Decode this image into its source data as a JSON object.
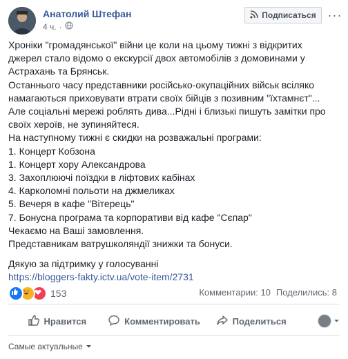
{
  "post": {
    "author": "Анатолий Штефан",
    "time": "4 ч.",
    "subscribe_label": "Подписаться",
    "lines": [
      "Хроніки \"громадянської\" війни це коли на цьому тижні з відкритих",
      "джерел стало відомо о екскурсії двох автомобілів з домовинами у",
      "Астрахань та Брянськ.",
      "Останнього часу представники російсько-окупаційних військ всіляко",
      "намагаються приховувати втрати своїх бійців з позивним \"їхтамнєт\"...",
      "Але соціальні мережі роблять дива...Рідні і близькі пишуть замітки про",
      "своїх хероїв, не зупиняйтеся.",
      "На наступному тижні є скидки на розважальні програми:",
      "1. Концерт Кобзона",
      "1. Концерт хору Александрова",
      "3. Захоплюючі поїздки в ліфтових кабінах",
      "4. Карколомні польоти на джмеликах",
      "5. Вечеря в кафе \"Вітерець\"",
      "7. Бонусна програма та корпоративи від кафе \"Сєпар\"",
      "Чекаємо на Ваші замовлення.",
      "Представникам ватрушколяндії знижки та бонуси."
    ],
    "thanks": "Дякую за підтримку у голосуванні",
    "link": "https://bloggers-fakty.ictv.ua/vote-item/2731"
  },
  "reactions": {
    "icons": [
      "like-reaction",
      "haha-reaction",
      "love-reaction"
    ],
    "count": "153",
    "comments": "Комментарии: 10",
    "shares": "Поделились: 8"
  },
  "actions": {
    "like": "Нравится",
    "comment": "Комментировать",
    "share": "Поделиться"
  },
  "sort": {
    "label": "Самые актуальные"
  },
  "colors": {
    "link": "#385898",
    "like": "#1877f2",
    "haha": "#f7b125",
    "love": "#f33e58"
  }
}
